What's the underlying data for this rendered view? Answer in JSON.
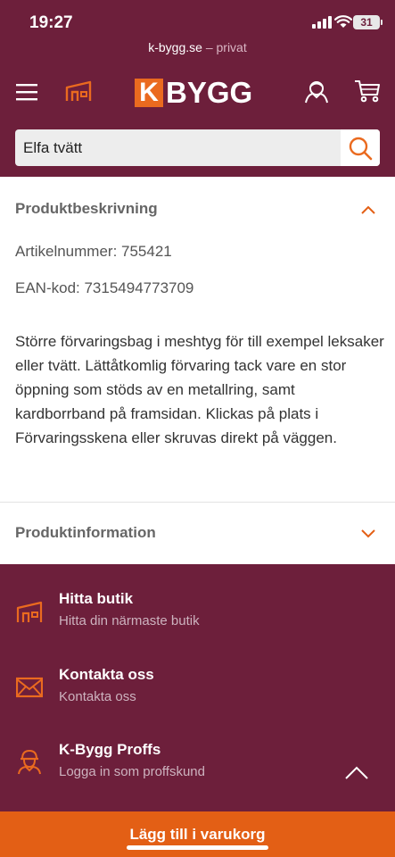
{
  "status_bar": {
    "time": "19:27",
    "battery": "31"
  },
  "browser": {
    "domain": "k-bygg.se",
    "mode": " – privat"
  },
  "header": {
    "logo_mark": "K",
    "logo_text": "BYGG"
  },
  "search": {
    "value": "Elfa tvätt",
    "clear": "×"
  },
  "description_section": {
    "title": "Produktbeskrivning",
    "article_number": "Artikelnummer: 755421",
    "ean": "EAN-kod: 7315494773709",
    "text": "Större förvaringsbag i meshtyg för till exempel leksaker eller tvätt. Lättåtkomlig förvaring tack vare en stor öppning som stöds av en metallring, samt kardborrband på framsidan. Klickas på plats i Förvaringsskena eller skruvas direkt på väggen."
  },
  "info_section": {
    "title": "Produktinformation"
  },
  "footer": {
    "items": [
      {
        "title": "Hitta butik",
        "subtitle": "Hitta din närmaste butik"
      },
      {
        "title": "Kontakta oss",
        "subtitle": "Kontakta oss"
      },
      {
        "title": "K-Bygg Proffs",
        "subtitle": "Logga in som proffskund"
      }
    ]
  },
  "cta": {
    "label": "Lägg till i varukorg"
  },
  "colors": {
    "brand": "#6d1f3b",
    "accent": "#e35f15"
  }
}
